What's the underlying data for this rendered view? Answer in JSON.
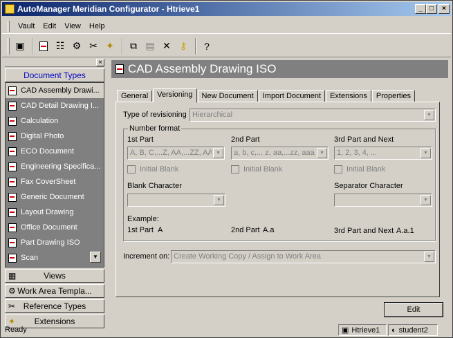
{
  "window": {
    "title": "AutoManager Meridian Configurator - Htrieve1"
  },
  "menu": [
    "Vault",
    "Edit",
    "View",
    "Help"
  ],
  "toolbar": {
    "icons": [
      "vault-icon",
      "document-icon",
      "tree-icon",
      "settings-icon",
      "tools-icon",
      "extension-icon",
      "copy-icon",
      "paste-icon",
      "delete-icon",
      "key-icon",
      "help-icon"
    ]
  },
  "left_panel": {
    "document_types_label": "Document Types",
    "document_types": [
      "CAD Assembly Drawi...",
      "CAD Detail Drawing I...",
      "Calculation",
      "Digital Photo",
      "ECO Document",
      "Engineering Specifica...",
      "Fax CoverSheet",
      "Generic Document",
      "Layout Drawing",
      "Office Document",
      "Part Drawing ISO",
      "Scan"
    ],
    "sections": [
      "Views",
      "Work Area Templa...",
      "Reference Types",
      "Extensions"
    ]
  },
  "detail": {
    "header_title": "CAD Assembly Drawing ISO",
    "tabs": [
      "General",
      "Versioning",
      "New Document",
      "Import Document",
      "Extensions",
      "Properties"
    ],
    "active_tab": "Versioning",
    "type_of_revisioning_label": "Type of revisioning",
    "type_of_revisioning_value": "Hierarchical",
    "number_format_label": "Number format",
    "part1_label": "1st Part",
    "part1_value": "A, B, C,...Z, AA,...ZZ, AAA",
    "part2_label": "2nd Part",
    "part2_value": "a, b, c,... z, aa,...zz, aaa,...",
    "part3_label": "3rd Part and Next",
    "part3_value": "1, 2, 3, 4, ...",
    "initial_blank_label": "Initial Blank",
    "blank_character_label": "Blank Character",
    "separator_character_label": "Separator Character",
    "example_label": "Example:",
    "example_part1_label": "1st Part",
    "example_part1_value": "A",
    "example_part2_label": "2nd Part",
    "example_part2_value": "A.a",
    "example_part3_label": "3rd Part and Next",
    "example_part3_value": "A.a.1",
    "increment_on_label": "Increment on:",
    "increment_on_value": "Create Working Copy / Assign to Work Area",
    "edit_button": "Edit"
  },
  "status": {
    "text": "Ready",
    "vault": "Htrieve1",
    "user": "student2"
  }
}
